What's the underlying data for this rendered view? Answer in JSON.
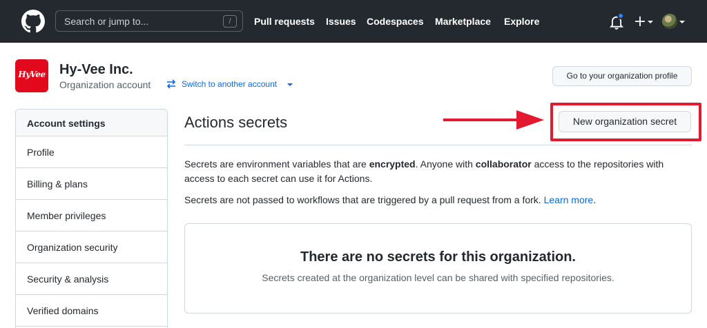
{
  "header": {
    "search_placeholder": "Search or jump to...",
    "search_shortcut": "/",
    "nav": [
      "Pull requests",
      "Issues",
      "Codespaces",
      "Marketplace",
      "Explore"
    ],
    "notification_dot_color": "#2f81f7",
    "icons": [
      "github-logo-icon",
      "bell-icon",
      "plus-icon",
      "avatar",
      "caret-down-icon"
    ]
  },
  "org": {
    "logo_text": "HyVee",
    "name": "Hy-Vee Inc.",
    "subtitle": "Organization account",
    "switch_label": "Switch to another account",
    "profile_button": "Go to your organization profile",
    "brand_color": "#e1091b"
  },
  "sidebar": {
    "title": "Account settings",
    "items": [
      {
        "label": "Profile"
      },
      {
        "label": "Billing & plans"
      },
      {
        "label": "Member privileges"
      },
      {
        "label": "Organization security"
      },
      {
        "label": "Security & analysis"
      },
      {
        "label": "Verified domains"
      }
    ]
  },
  "main": {
    "title": "Actions secrets",
    "new_button": "New organization secret",
    "para1_a": "Secrets are environment variables that are ",
    "para1_b": "encrypted",
    "para1_c": ". Anyone with ",
    "para1_d": "collaborator",
    "para1_e": " access to the repositories with access to each secret can use it for Actions.",
    "para2_a": "Secrets are not passed to workflows that are triggered by a pull request from a fork. ",
    "para2_link": "Learn more",
    "para2_end": ".",
    "blank_title": "There are no secrets for this organization.",
    "blank_sub": "Secrets created at the organization level can be shared with specified repositories.",
    "annotation_color": "#e3192f"
  }
}
